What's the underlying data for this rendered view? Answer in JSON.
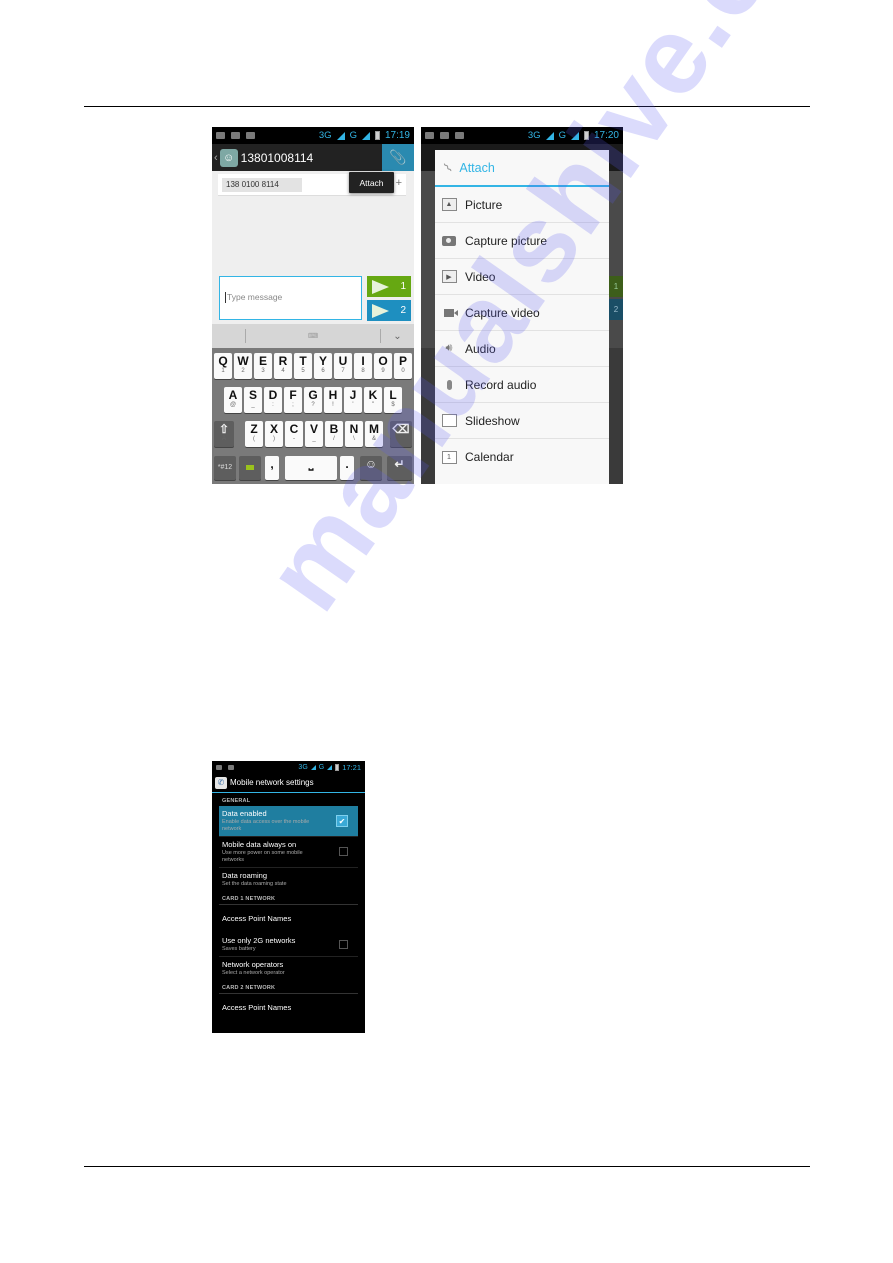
{
  "document": {
    "watermark": "manualshive.com"
  },
  "screen1": {
    "status": {
      "time": "17:19",
      "net1": "3G",
      "net2": "G"
    },
    "header": {
      "contact": "13801008114",
      "attach_icon": "paperclip-icon"
    },
    "recipient": "138 0100 8114",
    "tooltip": "Attach",
    "message_input": {
      "placeholder": "Type message",
      "value": ""
    },
    "send_buttons": [
      {
        "label": "1",
        "color": "#66a812"
      },
      {
        "label": "2",
        "color": "#1e8fc0"
      }
    ],
    "keyboard": {
      "row1": [
        {
          "k": "Q",
          "s": "1"
        },
        {
          "k": "W",
          "s": "2"
        },
        {
          "k": "E",
          "s": "3"
        },
        {
          "k": "R",
          "s": "4"
        },
        {
          "k": "T",
          "s": "5"
        },
        {
          "k": "Y",
          "s": "6"
        },
        {
          "k": "U",
          "s": "7"
        },
        {
          "k": "I",
          "s": "8"
        },
        {
          "k": "O",
          "s": "9"
        },
        {
          "k": "P",
          "s": "0"
        }
      ],
      "row2": [
        {
          "k": "A",
          "s": "@"
        },
        {
          "k": "S",
          "s": "_"
        },
        {
          "k": "D",
          "s": ":"
        },
        {
          "k": "F",
          "s": ";"
        },
        {
          "k": "G",
          "s": "?"
        },
        {
          "k": "H",
          "s": "!"
        },
        {
          "k": "J",
          "s": "'"
        },
        {
          "k": "K",
          "s": "\""
        },
        {
          "k": "L",
          "s": "$"
        }
      ],
      "row3": [
        {
          "k": "Z",
          "s": "("
        },
        {
          "k": "X",
          "s": ")"
        },
        {
          "k": "C",
          "s": "-"
        },
        {
          "k": "V",
          "s": "_"
        },
        {
          "k": "B",
          "s": "/"
        },
        {
          "k": "N",
          "s": "\\"
        },
        {
          "k": "M",
          "s": "&"
        }
      ],
      "shift_sub": "A",
      "symbols_label": "*#12",
      "comma": ",",
      "period": "."
    }
  },
  "screen2": {
    "status": {
      "time": "17:20",
      "net1": "3G",
      "net2": "G"
    },
    "dialog": {
      "title": "Attach",
      "items": [
        {
          "label": "Picture",
          "icon": "picture-icon"
        },
        {
          "label": "Capture picture",
          "icon": "camera-icon"
        },
        {
          "label": "Video",
          "icon": "video-icon"
        },
        {
          "label": "Capture video",
          "icon": "video-camera-icon"
        },
        {
          "label": "Audio",
          "icon": "speaker-icon"
        },
        {
          "label": "Record audio",
          "icon": "microphone-icon"
        },
        {
          "label": "Slideshow",
          "icon": "slideshow-icon"
        },
        {
          "label": "Calendar",
          "icon": "calendar-icon",
          "glyph": "1"
        }
      ]
    },
    "background_send_labels": [
      "1",
      "2"
    ]
  },
  "screen3": {
    "status": {
      "time": "17:21",
      "net1": "3G",
      "net2": "G"
    },
    "title": "Mobile network settings",
    "sections": [
      {
        "header": "GENERAL",
        "items": [
          {
            "title": "Data enabled",
            "summary": "Enable data access over the mobile network",
            "checkbox": true,
            "checked": true,
            "highlighted": true
          },
          {
            "title": "Mobile data always on",
            "summary": "Use more power on some mobile networks",
            "checkbox": true,
            "checked": false
          },
          {
            "title": "Data roaming",
            "summary": "Set the data roaming state"
          }
        ]
      },
      {
        "header": "CARD 1 NETWORK",
        "items": [
          {
            "title": "Access Point Names"
          },
          {
            "title": "Use only 2G networks",
            "summary": "Saves battery",
            "checkbox": true,
            "checked": false
          },
          {
            "title": "Network operators",
            "summary": "Select a network operator"
          }
        ]
      },
      {
        "header": "CARD 2 NETWORK",
        "items": [
          {
            "title": "Access Point Names"
          }
        ]
      }
    ]
  }
}
